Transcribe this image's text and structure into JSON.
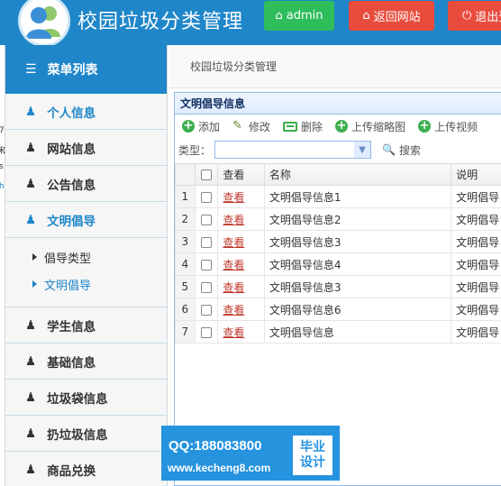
{
  "header": {
    "title": "校园垃圾分类管理",
    "admin_label": "admin",
    "back_label": "返回网站",
    "logout_label": "退出登"
  },
  "stray_chars": [
    "7",
    "和",
    "s",
    "h"
  ],
  "sidebar": {
    "menu_title": "菜单列表",
    "items": [
      {
        "label": "个人信息",
        "active": true
      },
      {
        "label": "网站信息"
      },
      {
        "label": "公告信息"
      },
      {
        "label": "文明倡导",
        "active": true
      },
      {
        "label": "学生信息"
      },
      {
        "label": "基础信息"
      },
      {
        "label": "垃圾袋信息"
      },
      {
        "label": "扔垃圾信息"
      },
      {
        "label": "商品兑换"
      }
    ],
    "sub_items": [
      {
        "label": "倡导类型"
      },
      {
        "label": "文明倡导",
        "active": true
      }
    ]
  },
  "breadcrumb": "校园垃圾分类管理",
  "panel": {
    "title": "文明倡导信息",
    "toolbar": {
      "add": "添加",
      "edit": "修改",
      "delete": "删除",
      "upload_thumb": "上传缩略图",
      "upload_video": "上传视频"
    },
    "filter": {
      "type_label": "类型：",
      "search_label": "搜索"
    },
    "table": {
      "headers": {
        "view": "查看",
        "name": "名称",
        "desc": "说明"
      },
      "rows": [
        {
          "num": "1",
          "view": "查看",
          "name": "文明倡导信息1",
          "desc": "文明倡导"
        },
        {
          "num": "2",
          "view": "查看",
          "name": "文明倡导信息2",
          "desc": "文明倡导"
        },
        {
          "num": "3",
          "view": "查看",
          "name": "文明倡导信息3",
          "desc": "文明倡导"
        },
        {
          "num": "4",
          "view": "查看",
          "name": "文明倡导信息4",
          "desc": "文明倡导"
        },
        {
          "num": "5",
          "view": "查看",
          "name": "文明倡导信息3",
          "desc": "文明倡导"
        },
        {
          "num": "6",
          "view": "查看",
          "name": "文明倡导信息6",
          "desc": "文明倡导"
        },
        {
          "num": "7",
          "view": "查看",
          "name": "文明倡导信息",
          "desc": "文明倡导"
        }
      ]
    }
  },
  "watermark": {
    "qq": "QQ:188083800",
    "url": "www.kecheng8.com",
    "tag_line1": "毕业",
    "tag_line2": "设计"
  },
  "colors": {
    "brand_blue": "#1f86c9",
    "green": "#2ebd5a",
    "red": "#e84c3d"
  }
}
